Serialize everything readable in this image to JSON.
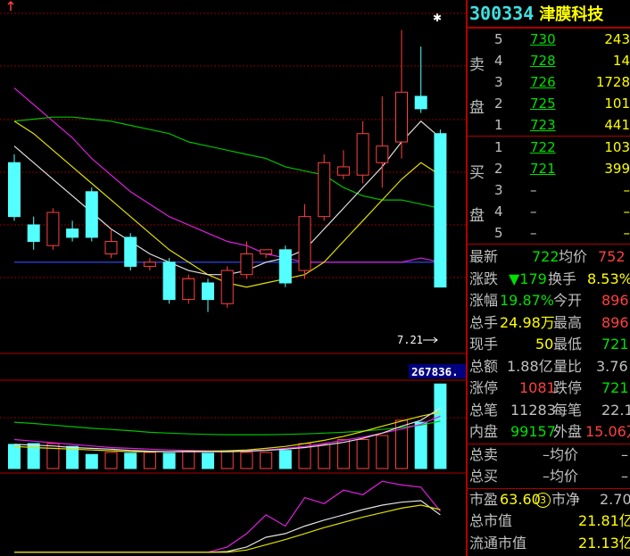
{
  "stock": {
    "code": "300334",
    "name": "津膜科技"
  },
  "orderbook": {
    "sell_label_top": "卖",
    "sell_label_bottom": "盘",
    "buy_label_top": "买",
    "buy_label_bottom": "盘",
    "sells": [
      {
        "level": "5",
        "price": "730",
        "volume": "243"
      },
      {
        "level": "4",
        "price": "728",
        "volume": "14"
      },
      {
        "level": "3",
        "price": "726",
        "volume": "1728"
      },
      {
        "level": "2",
        "price": "725",
        "volume": "101"
      },
      {
        "level": "1",
        "price": "723",
        "volume": "441"
      }
    ],
    "buys": [
      {
        "level": "1",
        "price": "722",
        "volume": "103"
      },
      {
        "level": "2",
        "price": "721",
        "volume": "399"
      },
      {
        "level": "3",
        "price": "–",
        "volume": "–"
      },
      {
        "level": "4",
        "price": "–",
        "volume": "–"
      },
      {
        "level": "5",
        "price": "–",
        "volume": "–"
      }
    ]
  },
  "quote": {
    "latest_label": "最新",
    "latest_value": "722",
    "avg_label": "均价",
    "avg_value": "752",
    "change_label": "涨跌",
    "change_value": "▼179",
    "turnover_label": "换手",
    "turnover_value": "8.53%",
    "pct_label": "涨幅",
    "pct_value": "19.87%",
    "open_label": "今开",
    "open_value": "896",
    "hand_label": "总手",
    "hand_value": "24.98万",
    "high_label": "最高",
    "high_value": "896",
    "cur_label": "现手",
    "cur_value": "50",
    "low_label": "最低",
    "low_value": "721",
    "amount_label": "总额",
    "amount_value": "1.88亿",
    "ratio_label": "量比",
    "ratio_value": "3.76",
    "limitup_label": "涨停",
    "limitup_value": "1081",
    "limitdown_label": "跌停",
    "limitdown_value": "721",
    "deals_label": "总笔",
    "deals_value": "11283",
    "per_label": "每笔",
    "per_value": "22.1",
    "inner_label": "内盘",
    "inner_value": "99157",
    "outer_label": "外盘",
    "outer_value": "15.06万",
    "totsell_label": "总卖",
    "totsell_value": "–均价",
    "totsell_tail": "–",
    "totbuy_label": "总买",
    "totbuy_value": "–均价",
    "totbuy_tail": "–",
    "pe_label": "市盈",
    "pe_value": "63.60",
    "pe_badge": "3",
    "pb_label": "市净",
    "pb_value": "2.70",
    "mcap_label": "总市值",
    "mcap_value": "21.81亿",
    "float_label": "流通市值",
    "float_value": "21.13亿"
  },
  "chart": {
    "price_marker": "7.21",
    "volume_label": "267836.",
    "star": "✱"
  },
  "chart_data": {
    "type": "candlestick",
    "candles": [
      {
        "o": 10.2,
        "c": 8.9,
        "h": 10.4,
        "l": 8.8
      },
      {
        "o": 8.7,
        "c": 8.3,
        "h": 8.9,
        "l": 8.1
      },
      {
        "o": 8.2,
        "c": 9.0,
        "h": 9.1,
        "l": 8.1
      },
      {
        "o": 8.6,
        "c": 8.4,
        "h": 8.8,
        "l": 8.3
      },
      {
        "o": 9.5,
        "c": 8.4,
        "h": 9.6,
        "l": 8.3
      },
      {
        "o": 8.0,
        "c": 8.3,
        "h": 8.6,
        "l": 7.9
      },
      {
        "o": 8.4,
        "c": 7.7,
        "h": 8.5,
        "l": 7.6
      },
      {
        "o": 7.7,
        "c": 7.8,
        "h": 7.9,
        "l": 7.6
      },
      {
        "o": 7.8,
        "c": 6.9,
        "h": 7.9,
        "l": 6.8
      },
      {
        "o": 6.9,
        "c": 7.4,
        "h": 7.5,
        "l": 6.8
      },
      {
        "o": 7.3,
        "c": 6.9,
        "h": 7.4,
        "l": 6.6
      },
      {
        "o": 6.8,
        "c": 7.6,
        "h": 7.7,
        "l": 6.7
      },
      {
        "o": 7.5,
        "c": 8.0,
        "h": 8.3,
        "l": 7.4
      },
      {
        "o": 8.0,
        "c": 8.1,
        "h": 8.1,
        "l": 7.9
      },
      {
        "o": 8.1,
        "c": 7.3,
        "h": 8.2,
        "l": 7.2
      },
      {
        "o": 7.6,
        "c": 8.9,
        "h": 9.2,
        "l": 7.4
      },
      {
        "o": 8.9,
        "c": 10.2,
        "h": 10.4,
        "l": 8.8
      },
      {
        "o": 9.9,
        "c": 10.1,
        "h": 10.5,
        "l": 9.8
      },
      {
        "o": 9.9,
        "c": 10.9,
        "h": 11.2,
        "l": 9.7
      },
      {
        "o": 10.2,
        "c": 10.6,
        "h": 11.8,
        "l": 9.6
      },
      {
        "o": 10.7,
        "c": 11.9,
        "h": 13.4,
        "l": 10.3
      },
      {
        "o": 11.8,
        "c": 11.5,
        "h": 13.0,
        "l": 11.4
      },
      {
        "o": 10.9,
        "c": 7.2,
        "h": 11.0,
        "l": 7.2
      }
    ],
    "ma_white": [
      10.6,
      10.2,
      9.8,
      9.4,
      9.0,
      8.6,
      8.3,
      8.0,
      7.8,
      7.6,
      7.5,
      7.5,
      7.6,
      7.8,
      7.9,
      8.1,
      8.6,
      9.1,
      9.6,
      10.1,
      10.7,
      11.2,
      10.8
    ],
    "ma_yellow": [
      11.2,
      10.9,
      10.5,
      10.1,
      9.7,
      9.3,
      8.9,
      8.5,
      8.1,
      7.8,
      7.5,
      7.3,
      7.2,
      7.3,
      7.4,
      7.5,
      7.8,
      8.3,
      8.8,
      9.3,
      9.8,
      10.2,
      9.9
    ],
    "ma_green": [
      11.2,
      11.25,
      11.3,
      11.3,
      11.25,
      11.2,
      11.1,
      11.0,
      10.9,
      10.7,
      10.6,
      10.5,
      10.4,
      10.3,
      10.1,
      10.0,
      9.9,
      9.6,
      9.4,
      9.3,
      9.3,
      9.2,
      9.1
    ],
    "ma_magenta": [
      12.0,
      11.6,
      11.2,
      10.8,
      10.3,
      9.9,
      9.5,
      9.2,
      8.9,
      8.7,
      8.5,
      8.3,
      8.2,
      8.0,
      7.9,
      7.8,
      7.8,
      7.8,
      7.8,
      7.8,
      7.8,
      7.9,
      7.8
    ],
    "ma_blue": [
      7.8,
      7.8,
      7.8,
      7.8,
      7.8,
      7.8,
      7.8,
      7.8,
      7.8,
      7.8,
      7.8,
      7.8,
      7.8,
      7.8,
      7.8,
      7.8,
      7.8,
      7.8,
      7.8,
      7.8,
      7.8,
      7.8,
      7.8
    ],
    "volumes": [
      60,
      62,
      62,
      55,
      35,
      40,
      38,
      40,
      38,
      45,
      38,
      42,
      40,
      40,
      45,
      62,
      60,
      72,
      72,
      82,
      120,
      115,
      210
    ],
    "volume_ma_green": [
      115,
      112,
      108,
      104,
      100,
      97,
      94,
      90,
      88,
      86,
      85,
      84,
      84,
      84,
      85,
      86,
      88,
      90,
      93,
      97,
      102,
      108,
      118
    ],
    "volume_ma_white": [
      60,
      58,
      56,
      52,
      50,
      48,
      45,
      43,
      42,
      42,
      42,
      42,
      43,
      45,
      48,
      52,
      58,
      65,
      75,
      88,
      105,
      120,
      150
    ],
    "volume_ma_magenta": [
      72,
      68,
      64,
      60,
      56,
      52,
      50,
      48,
      46,
      45,
      44,
      43,
      44,
      46,
      50,
      55,
      62,
      70,
      78,
      88,
      98,
      110,
      130
    ],
    "volume_ma_yellow": [
      55,
      52,
      50,
      48,
      46,
      44,
      42,
      42,
      42,
      43,
      43,
      44,
      46,
      50,
      55,
      62,
      70,
      80,
      92,
      105,
      118,
      130,
      140
    ],
    "indicator_magenta": [
      5,
      5,
      5,
      5,
      5,
      5,
      5,
      5,
      5,
      5,
      5,
      12,
      30,
      55,
      40,
      78,
      70,
      88,
      82,
      100,
      95,
      92,
      60
    ],
    "indicator_white": [
      5,
      5,
      5,
      5,
      5,
      5,
      5,
      5,
      5,
      5,
      5,
      6,
      12,
      25,
      30,
      40,
      48,
      55,
      62,
      68,
      72,
      74,
      55
    ],
    "indicator_yellow": [
      5,
      5,
      5,
      5,
      5,
      5,
      5,
      5,
      5,
      5,
      5,
      5,
      8,
      15,
      22,
      30,
      38,
      45,
      52,
      58,
      64,
      68,
      62
    ]
  }
}
